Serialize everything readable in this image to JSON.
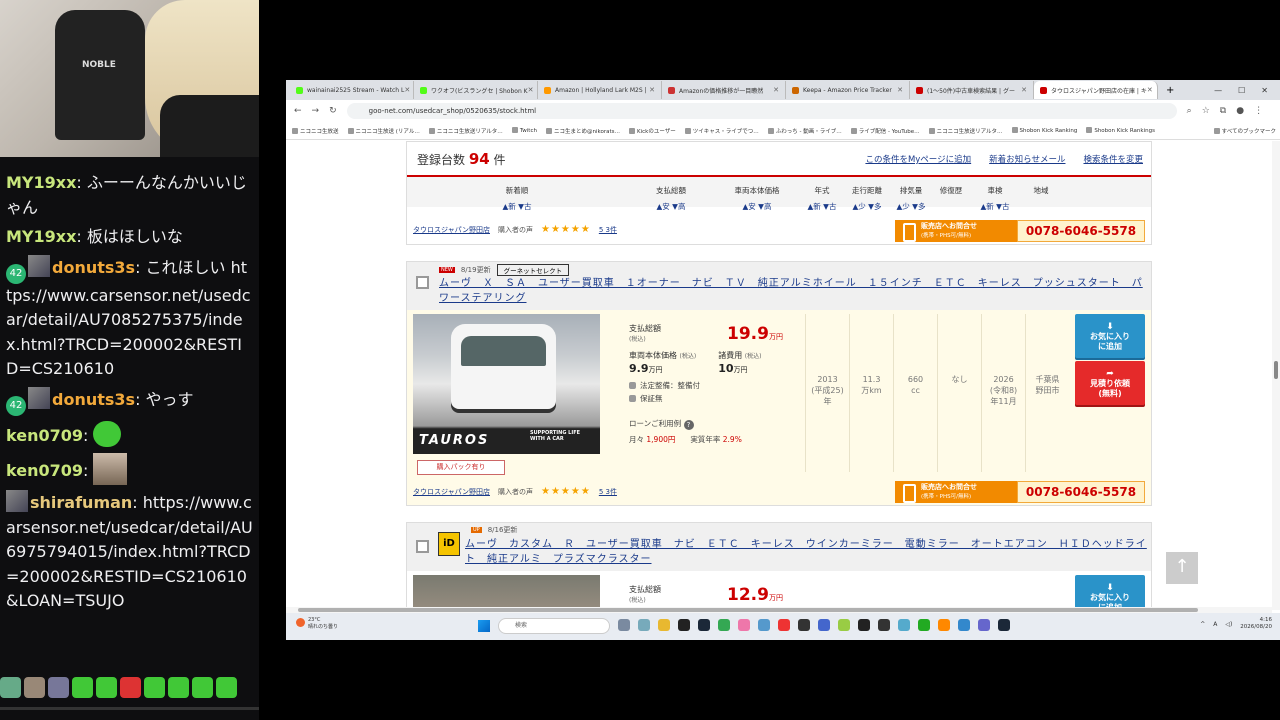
{
  "webcam": {
    "chair_brand": "NOBLE"
  },
  "chat": {
    "messages": [
      {
        "user": "MY19xx",
        "text": "ふーーんなんかいいじゃん"
      },
      {
        "user": "MY19xx",
        "text": "板はほしいな"
      },
      {
        "badge": "42",
        "user": "donuts3s",
        "text": "これほしい https://www.carsensor.net/usedcar/detail/AU7085275375/index.html?TRCD=200002&RESTID=CS210610"
      },
      {
        "badge": "42",
        "user": "donuts3s",
        "text": "やっす"
      },
      {
        "user": "ken0709",
        "text": ""
      },
      {
        "user": "ken0709",
        "text": ""
      },
      {
        "user": "shirafuman",
        "text": "https://www.carsensor.net/usedcar/detail/AU6975794015/index.html?TRCD=200002&RESTID=CS210610&LOAN=TSUJO"
      }
    ]
  },
  "browser": {
    "tabs": [
      "wainainai2525 Stream - Watch L",
      "ワクオフ(ビスラングセ | Shobon K",
      "Amazon | Hollyland Lark M2S |",
      "Amazonの価格推移が一目瞭然",
      "Keepa - Amazon Price Tracker",
      "(1〜50件)中古車検索結果 | グー",
      "タウロスジャパン野田店の在庫 | キ"
    ],
    "url": "goo-net.com/usedcar_shop/0520635/stock.html",
    "bookmarks": [
      "ニコニコ生放送",
      "ニコニコ生放送 (リアル…",
      "ニコニコ生放送リアルタ…",
      "Twitch",
      "ニコ生まとめ@nikorats…",
      "Kickのユーザー",
      "ツイキャス・ライブでつ…",
      "ふわっち - 動画・ライブ…",
      "ライブ配信 - YouTube…",
      "ニコニコ生放送リアルタ…",
      "Shobon Kick Ranking",
      "Shobon Kick Rankings"
    ],
    "bookmarks_right": "すべてのブックマーク"
  },
  "summary": {
    "count_label": "登録台数",
    "count": "94",
    "count_unit": "件",
    "links": [
      "この条件をMyページに追加",
      "新着お知らせメール",
      "検索条件を変更"
    ],
    "sort_columns": [
      {
        "label": "新着順",
        "arrows": "▲新 ▼古"
      },
      {
        "label": "支払総額",
        "arrows": "▲安 ▼高"
      },
      {
        "label": "車両本体価格",
        "arrows": "▲安 ▼高"
      },
      {
        "label": "年式",
        "arrows": "▲新 ▼古"
      },
      {
        "label": "走行距離",
        "arrows": "▲少 ▼多"
      },
      {
        "label": "排気量",
        "arrows": "▲少 ▼多"
      },
      {
        "label": "修復歴",
        "arrows": ""
      },
      {
        "label": "車検",
        "arrows": "▲新 ▼古"
      },
      {
        "label": "地域",
        "arrows": ""
      }
    ]
  },
  "dealer": {
    "name": "タウロスジャパン野田店",
    "reviews_label": "購入者の声",
    "stars": "★★★★★",
    "review_count": "5 3件",
    "contact_label": "販売店へお問合せ",
    "contact_sub": "(携帯・PHS可/無料)",
    "phone": "0078-6046-5578"
  },
  "listing1": {
    "updated": "8/19更新",
    "tag": "グーネットセレクト",
    "title": "ムーヴ　Ｘ　ＳＡ　ユーザー買取車　１オーナー　ナビ　ＴＶ　純正アルミホイール　１５インチ　ＥＴＣ　キーレス　プッシュスタート　パワーステアリング",
    "photo_logo": "TAUROS",
    "photo_slogan": "SUPPORTING LIFE WITH A CAR",
    "pack_button": "購入パック有り",
    "total_label": "支払総額",
    "total_sub": "(税込)",
    "total_price": "19.9",
    "price_unit": "万円",
    "body_label": "車両本体価格",
    "body_sub": "(税込)",
    "body_price": "9.9",
    "fees_label": "諸費用",
    "fees_sub": "(税込)",
    "fees_price": "10",
    "maintenance": "法定整備：整備付",
    "warranty": "保証無",
    "loan_label": "ローンご利用例",
    "monthly_label": "月々",
    "monthly": "1,900円",
    "rate_label": "実質年率",
    "rate": "2.9%",
    "specs": [
      "2013\n(平成25)\n年",
      "11.3\n万km",
      "660\ncc",
      "なし",
      "2026\n(令和8)\n年11月",
      "千葉県\n野田市"
    ],
    "fav_label": "お気に入り\nに追加",
    "estimate_label": "見積り依頼\n(無料)"
  },
  "listing2": {
    "updated": "8/16更新",
    "badge": "iD",
    "title": "ムーヴ　カスタム　Ｒ　ユーザー買取車　ナビ　ＥＴＣ　キーレス　ウインカーミラー　電動ミラー　オートエアコン　ＨＩＤヘッドライト　純正アルミ　プラズマクラスター",
    "total_label": "支払総額",
    "total_sub": "(税込)",
    "total_price": "12.9",
    "price_unit": "万円",
    "fav_label": "お気に入り\nに追加"
  },
  "taskbar": {
    "weather_temp": "23°C",
    "weather_text": "晴れのち曇り",
    "search_placeholder": "検索",
    "ime": "A",
    "time": "4:16",
    "date": "2026/08/20"
  }
}
